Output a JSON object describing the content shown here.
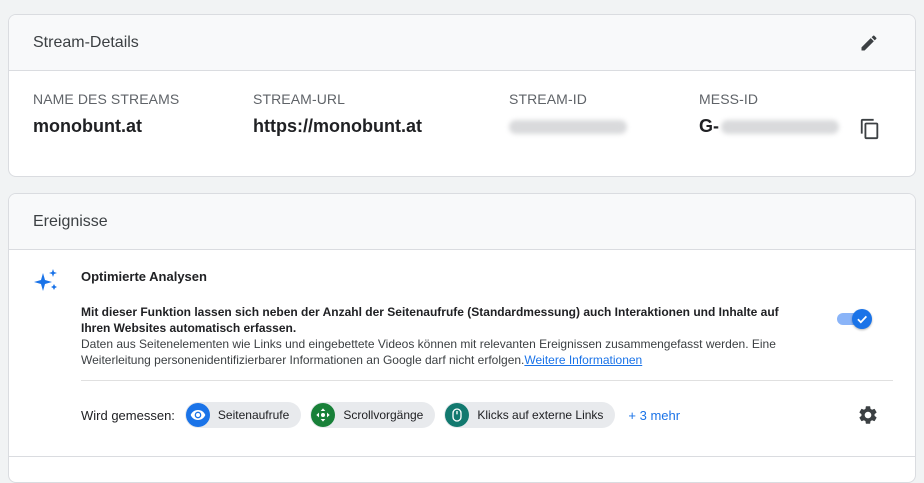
{
  "stream_card": {
    "title": "Stream-Details",
    "fields": [
      {
        "label": "NAME DES STREAMS",
        "value": "monobunt.at"
      },
      {
        "label": "STREAM-URL",
        "value": "https://monobunt.at"
      },
      {
        "label": "STREAM-ID",
        "value": ""
      },
      {
        "label": "MESS-ID",
        "value": "G-"
      }
    ]
  },
  "events_card": {
    "title": "Ereignisse",
    "enhanced": {
      "title": "Optimierte Analysen",
      "desc_bold": "Mit dieser Funktion lassen sich neben der Anzahl der Seitenaufrufe (Standardmessung) auch Interaktionen und Inhalte auf Ihren Websites automatisch erfassen.",
      "desc": "Daten aus Seitenelementen wie Links und eingebettete Videos können mit relevanten Ereignissen zusammengefasst werden. Eine Weiterleitung personenidentifizierbarer Informationen an Google darf nicht erfolgen.",
      "link": "Weitere Informationen",
      "toggle_on": true
    },
    "measured_label": "Wird gemessen:",
    "chips": [
      {
        "label": "Seitenaufrufe",
        "icon": "eye-icon",
        "color": "#1a73e8"
      },
      {
        "label": "Scrollvorgänge",
        "icon": "scroll-icon",
        "color": "#188038"
      },
      {
        "label": "Klicks auf externe Links",
        "icon": "mouse-icon",
        "color": "#12796f"
      }
    ],
    "more_link": "+ 3 mehr"
  },
  "colors": {
    "accent": "#1a73e8",
    "toggle_track": "#8ab4f8"
  }
}
